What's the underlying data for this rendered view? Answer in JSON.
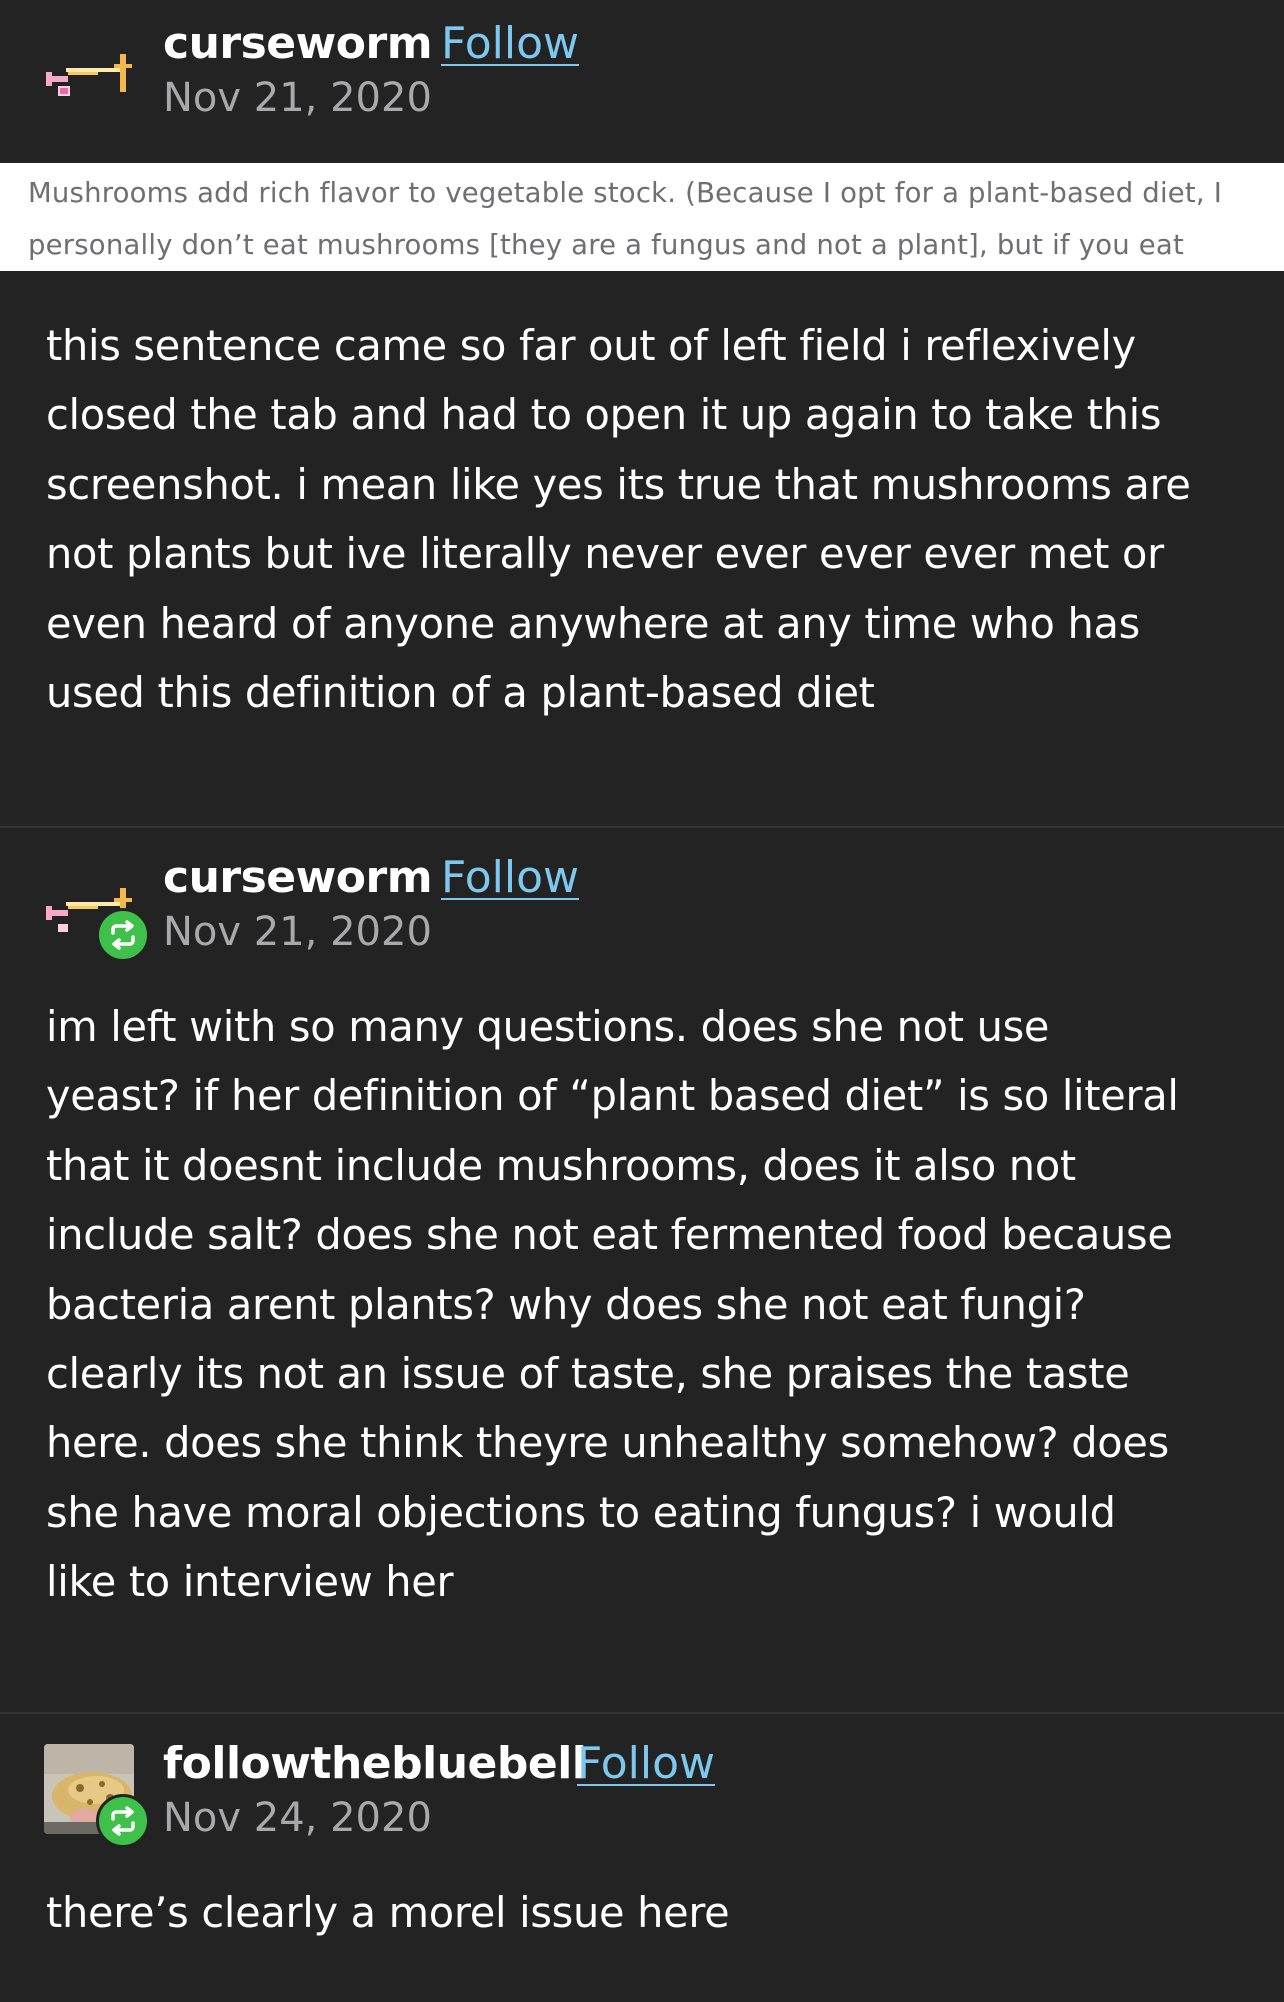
{
  "posts": [
    {
      "username": "curseworm",
      "follow_label": "Follow",
      "date": "Nov 21, 2020",
      "avatar_icon": "pixel-art-avatar-icon",
      "reblogged": false,
      "quoted_image_lines": [
        "Mushrooms add rich flavor to vegetable stock. (Because I opt for a plant-based diet, I",
        "personally don’t eat mushrooms [they are a fungus and not a plant], but if you eat"
      ],
      "body_lines": [
        "this sentence came so far out of left field i reflexively",
        "closed the tab and had to open it up again to take this",
        "screenshot. i mean like yes its true that mushrooms are",
        "not plants but ive literally never ever ever ever met or",
        "even heard of anyone anywhere at any time who has",
        "used this definition of a plant-based diet"
      ]
    },
    {
      "username": "curseworm",
      "follow_label": "Follow",
      "date": "Nov 21, 2020",
      "avatar_icon": "pixel-art-avatar-icon",
      "reblogged": true,
      "body_lines": [
        "im left with so many questions. does she not use",
        "yeast? if her definition of “plant based diet” is so literal",
        "that it doesnt include mushrooms, does it also not",
        "include salt? does she not eat fermented food because",
        "bacteria arent plants? why does she not eat fungi?",
        "clearly its not an issue of taste, she praises the taste",
        "here. does she think theyre unhealthy somehow? does",
        "she have moral objections to eating fungus? i would",
        "like to interview her"
      ]
    },
    {
      "username": "followthebluebell",
      "follow_label": "Follow",
      "date": "Nov 24, 2020",
      "avatar_icon": "photo-avatar-icon",
      "reblogged": true,
      "body_lines": [
        "there’s clearly a morel issue here"
      ]
    }
  ],
  "colors": {
    "background": "#232324",
    "follow_link": "#7ec8f0",
    "date_text": "#a9a9ab",
    "reblog_badge": "#3fc04a",
    "divider": "#343436"
  },
  "icons": {
    "reblog": "reblog-icon"
  }
}
